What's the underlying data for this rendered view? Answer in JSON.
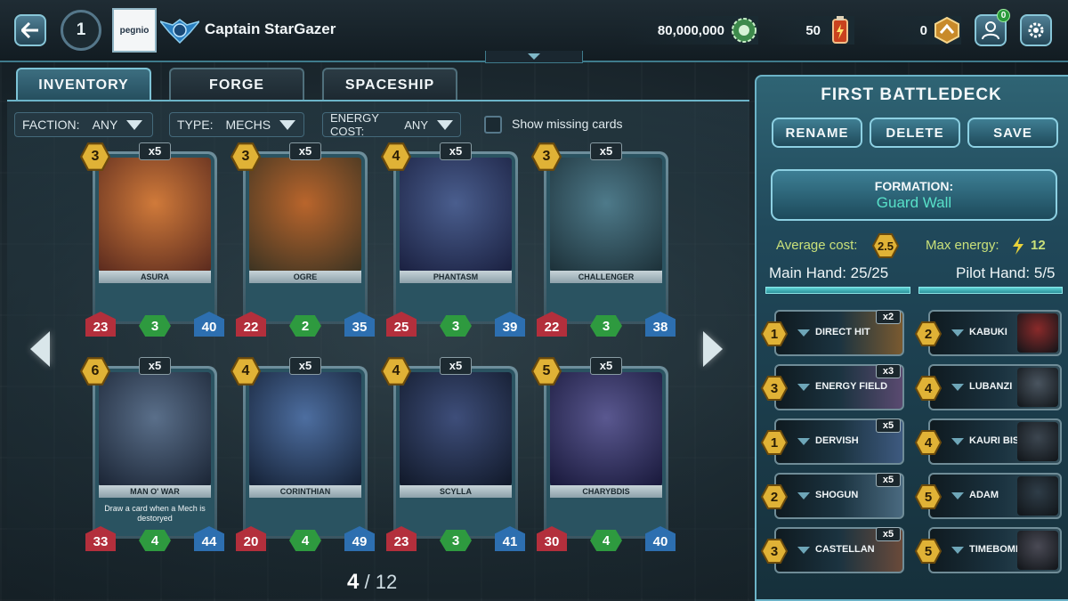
{
  "player": {
    "level": "1",
    "logo_text": "pegnio",
    "name": "Captain StarGazer"
  },
  "currencies": {
    "credits": "80,000,000",
    "energy": "50",
    "rank_points": "0"
  },
  "notifications": {
    "friends": "0"
  },
  "tabs": [
    {
      "label": "INVENTORY",
      "active": true
    },
    {
      "label": "FORGE",
      "active": false
    },
    {
      "label": "SPACESHIP",
      "active": false
    }
  ],
  "filters": {
    "faction_label": "FACTION:",
    "faction_value": "ANY",
    "type_label": "TYPE:",
    "type_value": "MECHS",
    "energy_label": "ENERGY COST:",
    "energy_value": "ANY",
    "missing_label": "Show missing cards"
  },
  "cards": [
    {
      "name": "ASURA",
      "cost": "3",
      "count": "x5",
      "attack": "23",
      "defense": "3",
      "health": "40",
      "text": "",
      "art": [
        "#d07a3a",
        "#5a2a1e"
      ]
    },
    {
      "name": "OGRE",
      "cost": "3",
      "count": "x5",
      "attack": "22",
      "defense": "2",
      "health": "35",
      "text": "",
      "art": [
        "#b9652c",
        "#3b3322"
      ]
    },
    {
      "name": "PHANTASM",
      "cost": "4",
      "count": "x5",
      "attack": "25",
      "defense": "3",
      "health": "39",
      "text": "",
      "art": [
        "#4a5e8e",
        "#1a2040"
      ]
    },
    {
      "name": "CHALLENGER",
      "cost": "3",
      "count": "x5",
      "attack": "22",
      "defense": "3",
      "health": "38",
      "text": "",
      "art": [
        "#4e7a8a",
        "#1c3038"
      ]
    },
    {
      "name": "MAN O' WAR",
      "cost": "6",
      "count": "x5",
      "attack": "33",
      "defense": "4",
      "health": "44",
      "text": "Draw a card when a Mech is destoryed",
      "art": [
        "#5a6f8a",
        "#1a2434"
      ]
    },
    {
      "name": "CORINTHIAN",
      "cost": "4",
      "count": "x5",
      "attack": "20",
      "defense": "4",
      "health": "49",
      "text": "",
      "art": [
        "#4d6ea0",
        "#142034"
      ]
    },
    {
      "name": "SCYLLA",
      "cost": "4",
      "count": "x5",
      "attack": "23",
      "defense": "3",
      "health": "41",
      "text": "",
      "art": [
        "#3e4e7a",
        "#101828"
      ]
    },
    {
      "name": "CHARYBDIS",
      "cost": "5",
      "count": "x5",
      "attack": "30",
      "defense": "4",
      "health": "40",
      "text": "",
      "art": [
        "#5a5890",
        "#18183a"
      ]
    }
  ],
  "pagination": {
    "current": "4",
    "separator": "/",
    "total": "12"
  },
  "deck": {
    "title": "FIRST BATTLEDECK",
    "rename_label": "RENAME",
    "delete_label": "DELETE",
    "save_label": "SAVE",
    "formation_label": "FORMATION:",
    "formation_value": "Guard Wall",
    "avg_cost_label": "Average cost:",
    "avg_cost_value": "2.5",
    "max_energy_label": "Max energy:",
    "max_energy_value": "12",
    "main_hand": "Main Hand: 25/25",
    "pilot_hand": "Pilot Hand: 5/5",
    "main_cards": [
      {
        "cost": "1",
        "name": "DIRECT HIT",
        "count": "x2"
      },
      {
        "cost": "3",
        "name": "ENERGY FIELD",
        "count": "x3"
      },
      {
        "cost": "1",
        "name": "DERVISH",
        "count": "x5"
      },
      {
        "cost": "2",
        "name": "SHOGUN",
        "count": "x5"
      },
      {
        "cost": "3",
        "name": "CASTELLAN",
        "count": "x5"
      }
    ],
    "pilot_cards": [
      {
        "cost": "2",
        "name": "KABUKI"
      },
      {
        "cost": "4",
        "name": "LUBANZI"
      },
      {
        "cost": "4",
        "name": "KAURI BISHOP"
      },
      {
        "cost": "5",
        "name": "ADAM"
      },
      {
        "cost": "5",
        "name": "TIMEBOMB"
      }
    ]
  },
  "colors": {
    "accent": "#6cb4c8",
    "cost_gold": "#e0b236",
    "attack_red": "#b32f3c",
    "defense_green": "#2e9a3f",
    "health_blue": "#2d6fb0",
    "formation_text": "#58e0c8"
  },
  "icons": {
    "back": "back-arrow-icon",
    "credits": "gear-coin-icon",
    "energy": "energy-canister-icon",
    "rank": "rank-emblem-icon",
    "friends": "friends-icon",
    "settings": "settings-gear-icon"
  }
}
